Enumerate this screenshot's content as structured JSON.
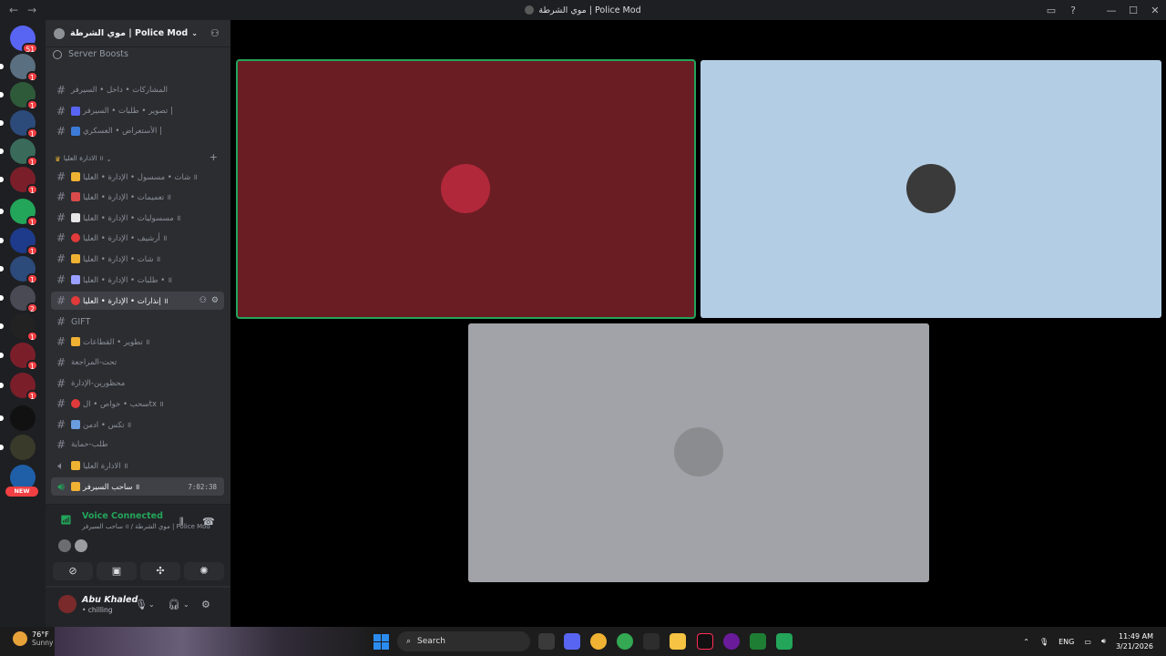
{
  "window": {
    "title": "موي الشرطة | Police Mod",
    "nav_back": "←",
    "nav_forward": "→",
    "inbox_icon": "inbox-icon",
    "help_icon": "help-icon"
  },
  "server_rail": {
    "items": [
      {
        "badge": "51",
        "color": "#5865f2"
      },
      {
        "badge": "1",
        "color": "#5a6f7f"
      },
      {
        "badge": "1",
        "color": "#2e5a3a"
      },
      {
        "badge": "1",
        "color": "#2c4a7a"
      },
      {
        "badge": "1",
        "color": "#3a6a5a"
      },
      {
        "badge": "1",
        "color": "#7a1f2a"
      },
      {
        "badge": "1",
        "color": "#23a55a"
      },
      {
        "badge": "1",
        "color": "#1e3a8a"
      },
      {
        "badge": "1",
        "color": "#2c4a7a"
      },
      {
        "badge": "2",
        "color": "#4a4a55"
      },
      {
        "badge": "1",
        "color": "#222222"
      },
      {
        "badge": "1",
        "color": "#7a1f2a"
      },
      {
        "badge": "1",
        "color": "#7a1f2a"
      },
      {
        "badge": "",
        "color": "#111111"
      },
      {
        "badge": "",
        "color": "#3a3a2a"
      },
      {
        "badge": "",
        "color": "#1e5fa8"
      }
    ],
    "new_label": "NEW"
  },
  "sidebar": {
    "server_name": "موي الشرطة | Police Mod",
    "server_boosts": "Server Boosts",
    "category": "الادارة العليا ॥",
    "channels": [
      {
        "name": "المشاركات • داخل • السيرفر",
        "emoji_color": ""
      },
      {
        "name": "تصوير • طلبات • السيرفر |",
        "emoji_color": "#5865f2"
      },
      {
        "name": "الأستعراض • العسكري |",
        "emoji_color": "#3d7bd9"
      },
      {
        "name": "شات • مسسول • الإدارة • العليا ॥",
        "emoji_color": "#f0b232"
      },
      {
        "name": "تعميمات • الإدارة • العليا ॥",
        "emoji_color": "#d94a4a"
      },
      {
        "name": "مسسوليات • الإدارة • العليا ॥",
        "emoji_color": "#e6e6e6"
      },
      {
        "name": "أرشيف • الإدارة • العليا ॥",
        "emoji_color": "#e03a3a"
      },
      {
        "name": "شات • الإدارة • العليا ॥",
        "emoji_color": "#f0b232"
      },
      {
        "name": "طلبات • الإدارة • العليا • ॥",
        "emoji_color": "#9aa0ff"
      },
      {
        "name": "إنذارات • الإدارة • العليا ॥",
        "emoji_color": "#e03a3a"
      },
      {
        "name": "GIFT",
        "emoji_color": ""
      },
      {
        "name": "تطوير • القطاعات ॥",
        "emoji_color": "#f0b232"
      },
      {
        "name": "تحت-المراجعة",
        "emoji_color": ""
      },
      {
        "name": "محظورين-الإدارة",
        "emoji_color": ""
      },
      {
        "name": "سحب • خواص • الtx ॥",
        "emoji_color": "#e03a3a"
      },
      {
        "name": "تكس • ادمن ॥",
        "emoji_color": "#6a9ce0"
      },
      {
        "name": "طلب-حماية",
        "emoji_color": ""
      },
      {
        "name": "الادارة العليا ॥",
        "emoji_color": "#f0b232"
      },
      {
        "name": "ساحب السيرفر ॥",
        "emoji_color": "#f0b232",
        "timer": "7:02:38"
      }
    ]
  },
  "voice": {
    "status": "Voice Connected",
    "location": "ساحب السيرفر ॥ / موي الشرطة | Police Mod"
  },
  "user": {
    "name": "Abu Khaled",
    "status": "• chilling"
  },
  "stage": {
    "tiles": [
      {
        "bg": "#6b1d24",
        "speaking": true,
        "avatar_color": "#b1283a"
      },
      {
        "bg": "#b3cde4",
        "speaking": false,
        "avatar_color": "#3a3a3a"
      },
      {
        "bg": "#a1a3a8",
        "speaking": false,
        "avatar_color": "#8a8c8f"
      }
    ]
  },
  "taskbar": {
    "temp": "76°F",
    "weather": "Sunny",
    "search": "Search",
    "lang": "ENG",
    "time": "11:49 AM",
    "date": "3/21/2026"
  }
}
